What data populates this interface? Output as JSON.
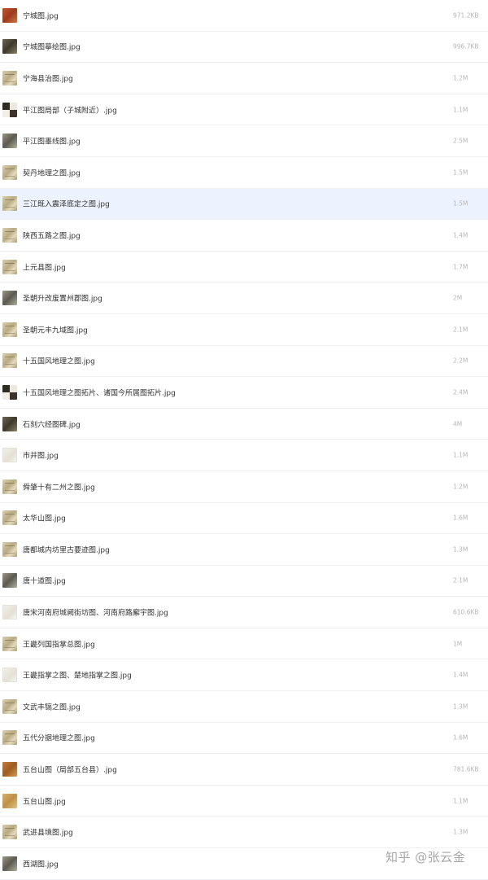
{
  "files": [
    {
      "name": "宁城图.jpg",
      "size": "971.2KB",
      "thumb_icon": "map-thumbnail-icon",
      "thumb_style": "red",
      "selected": false
    },
    {
      "name": "宁城图摹绘图.jpg",
      "size": "996.7KB",
      "thumb_icon": "map-thumbnail-icon",
      "thumb_style": "dark",
      "selected": false
    },
    {
      "name": "宁海县治图.jpg",
      "size": "1.2M",
      "thumb_icon": "map-thumbnail-icon",
      "thumb_style": "map",
      "selected": false
    },
    {
      "name": "平江图局部（子城附近）.jpg",
      "size": "1.1M",
      "thumb_icon": "map-thumbnail-icon",
      "thumb_style": "split",
      "selected": false
    },
    {
      "name": "平江图墨线图.jpg",
      "size": "2.5M",
      "thumb_icon": "map-thumbnail-icon",
      "thumb_style": "gray",
      "selected": false
    },
    {
      "name": "契丹地理之图.jpg",
      "size": "1.5M",
      "thumb_icon": "map-thumbnail-icon",
      "thumb_style": "map",
      "selected": false
    },
    {
      "name": "三江既入震泽底定之图.jpg",
      "size": "1.5M",
      "thumb_icon": "map-thumbnail-icon",
      "thumb_style": "map",
      "selected": true
    },
    {
      "name": "陕西五路之图.jpg",
      "size": "1.4M",
      "thumb_icon": "map-thumbnail-icon",
      "thumb_style": "map",
      "selected": false
    },
    {
      "name": "上元县图.jpg",
      "size": "1.7M",
      "thumb_icon": "map-thumbnail-icon",
      "thumb_style": "map",
      "selected": false
    },
    {
      "name": "圣朝升改废置州郡图.jpg",
      "size": "2M",
      "thumb_icon": "map-thumbnail-icon",
      "thumb_style": "gray",
      "selected": false
    },
    {
      "name": "圣朝元丰九域图.jpg",
      "size": "2.1M",
      "thumb_icon": "map-thumbnail-icon",
      "thumb_style": "map",
      "selected": false
    },
    {
      "name": "十五国风地理之图.jpg",
      "size": "2.2M",
      "thumb_icon": "map-thumbnail-icon",
      "thumb_style": "map",
      "selected": false
    },
    {
      "name": "十五国风地理之图拓片、诸国今所属图拓片.jpg",
      "size": "2.4M",
      "thumb_icon": "map-thumbnail-icon",
      "thumb_style": "split",
      "selected": false
    },
    {
      "name": "石刻六经图碑.jpg",
      "size": "4M",
      "thumb_icon": "map-thumbnail-icon",
      "thumb_style": "dark",
      "selected": false
    },
    {
      "name": "市井图.jpg",
      "size": "1.1M",
      "thumb_icon": "map-thumbnail-icon",
      "thumb_style": "light",
      "selected": false
    },
    {
      "name": "舜肇十有二州之图.jpg",
      "size": "1.2M",
      "thumb_icon": "map-thumbnail-icon",
      "thumb_style": "map",
      "selected": false
    },
    {
      "name": "太华山图.jpg",
      "size": "1.6M",
      "thumb_icon": "map-thumbnail-icon",
      "thumb_style": "map",
      "selected": false
    },
    {
      "name": "唐都城内坊里古要迹图.jpg",
      "size": "1.3M",
      "thumb_icon": "map-thumbnail-icon",
      "thumb_style": "map",
      "selected": false
    },
    {
      "name": "唐十道图.jpg",
      "size": "2.1M",
      "thumb_icon": "map-thumbnail-icon",
      "thumb_style": "gray",
      "selected": false
    },
    {
      "name": "唐宋河南府城阙街坊图、河南府路廨宇图.jpg",
      "size": "610.6KB",
      "thumb_icon": "map-thumbnail-icon",
      "thumb_style": "light",
      "selected": false
    },
    {
      "name": "王畿列国指掌总图.jpg",
      "size": "1M",
      "thumb_icon": "map-thumbnail-icon",
      "thumb_style": "map",
      "selected": false
    },
    {
      "name": "王畿指掌之图、楚地指掌之图.jpg",
      "size": "1.4M",
      "thumb_icon": "map-thumbnail-icon",
      "thumb_style": "light",
      "selected": false
    },
    {
      "name": "文武丰镐之图.jpg",
      "size": "1.3M",
      "thumb_icon": "map-thumbnail-icon",
      "thumb_style": "map",
      "selected": false
    },
    {
      "name": "五代分据地理之图.jpg",
      "size": "1.6M",
      "thumb_icon": "map-thumbnail-icon",
      "thumb_style": "map",
      "selected": false
    },
    {
      "name": "五台山图（局部五台县）.jpg",
      "size": "781.6KB",
      "thumb_icon": "map-thumbnail-icon",
      "thumb_style": "orange",
      "selected": false
    },
    {
      "name": "五台山图.jpg",
      "size": "1.1M",
      "thumb_icon": "map-thumbnail-icon",
      "thumb_style": "yellow",
      "selected": false
    },
    {
      "name": "武进县境图.jpg",
      "size": "1.3M",
      "thumb_icon": "map-thumbnail-icon",
      "thumb_style": "map",
      "selected": false
    },
    {
      "name": "西湖图.jpg",
      "size": "",
      "thumb_icon": "map-thumbnail-icon",
      "thumb_style": "gray",
      "selected": false
    }
  ],
  "watermark": "知乎 @张云金",
  "colors": {
    "selected_row": "#edf3fe",
    "file_name": "#333333",
    "file_size": "#b6b6b6",
    "divider": "#eef0f3"
  }
}
